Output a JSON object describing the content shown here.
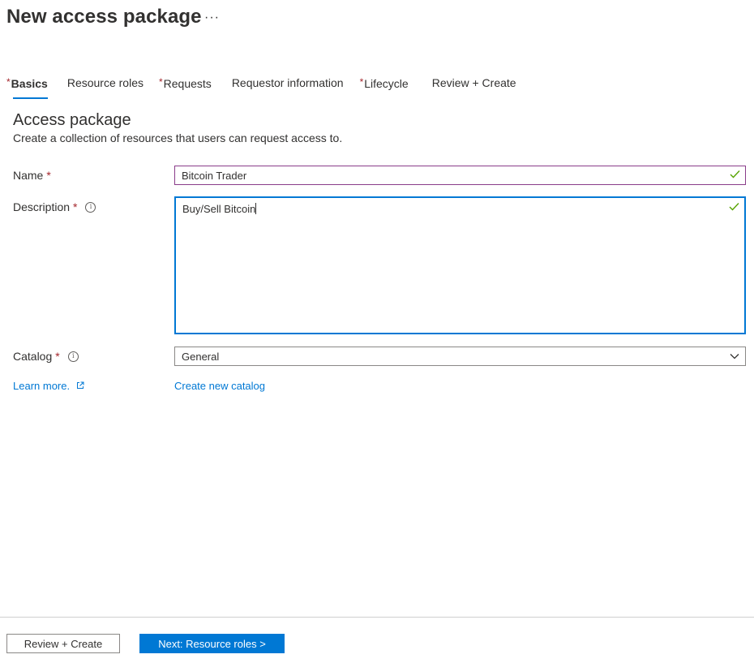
{
  "header": {
    "title": "New access package",
    "more_label": "···"
  },
  "tabs": [
    {
      "label": "Basics",
      "required": true,
      "active": true
    },
    {
      "label": "Resource roles",
      "required": false,
      "active": false
    },
    {
      "label": "Requests",
      "required": true,
      "active": false
    },
    {
      "label": "Requestor information",
      "required": false,
      "active": false
    },
    {
      "label": "Lifecycle",
      "required": true,
      "active": false
    },
    {
      "label": "Review + Create",
      "required": false,
      "active": false
    }
  ],
  "section": {
    "title": "Access package",
    "description": "Create a collection of resources that users can request access to."
  },
  "form": {
    "required_marker": "*",
    "name": {
      "label": "Name",
      "value": "Bitcoin Trader",
      "valid_icon": "checkmark-icon"
    },
    "description": {
      "label": "Description",
      "value": "Buy/Sell Bitcoin",
      "info_icon": "info-icon",
      "valid_icon": "checkmark-icon"
    },
    "catalog": {
      "label": "Catalog",
      "value": "General",
      "info_icon": "info-icon"
    },
    "learn_more": "Learn more.",
    "create_catalog": "Create new catalog"
  },
  "footer": {
    "review_create_label": "Review + Create",
    "next_label": "Next: Resource roles >"
  },
  "colors": {
    "accent": "#0078d4",
    "required": "#a4262c",
    "valid": "#57a300",
    "name_border": "#8a3c8a"
  }
}
